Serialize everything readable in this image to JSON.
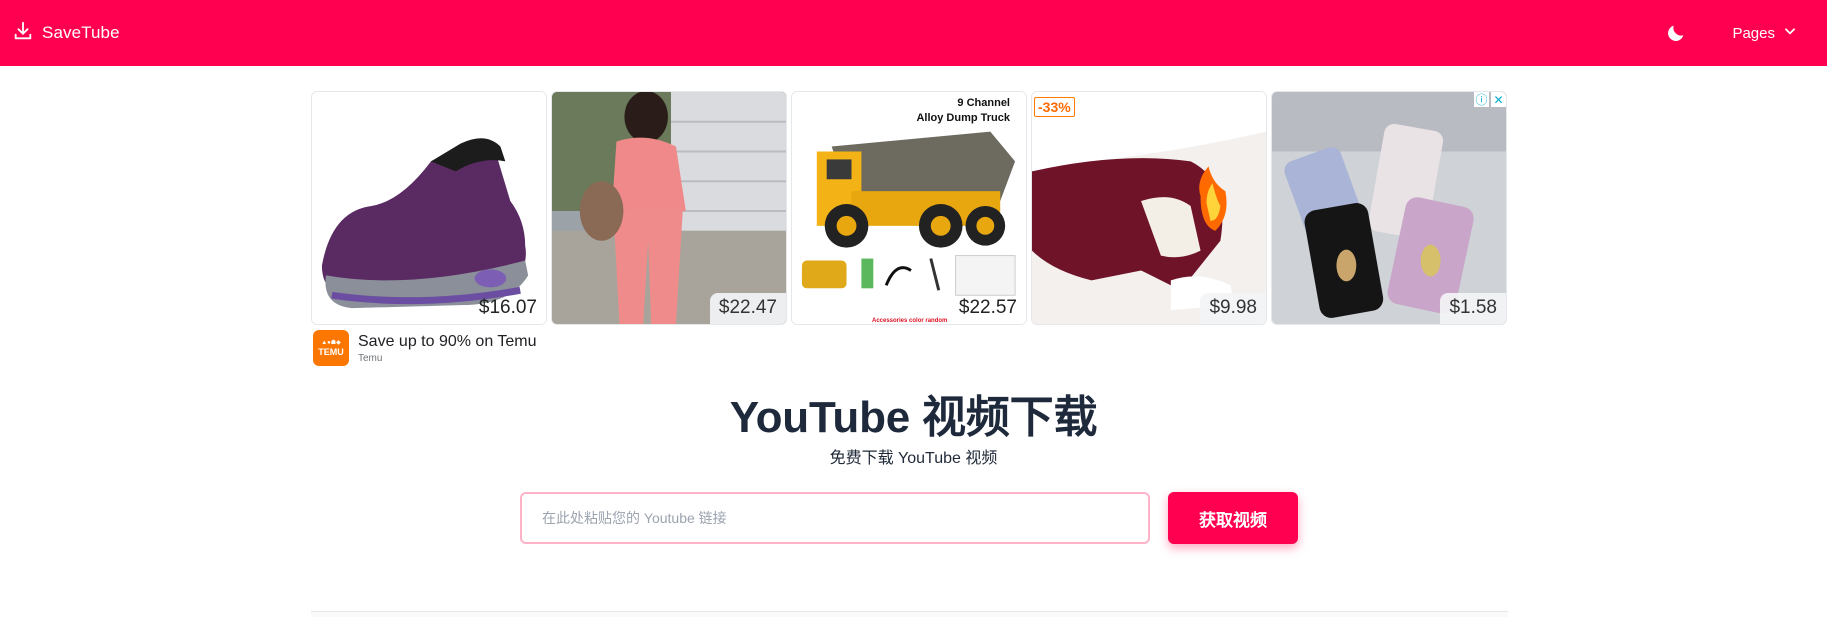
{
  "header": {
    "brand": "SaveTube",
    "pages_label": "Pages",
    "brand_color": "#ff0050",
    "icons": [
      "download-icon",
      "moon-icon",
      "chevron-down-icon"
    ]
  },
  "ad": {
    "cards": [
      {
        "price": "$16.07",
        "alt": "shoe"
      },
      {
        "price": "$22.47",
        "alt": "pink tracksuit"
      },
      {
        "price": "$22.57",
        "alt": "dump truck toy",
        "overlay_title": "9 Channel",
        "overlay_subtitle": "Alloy Dump Truck",
        "caption": "Accessories color random"
      },
      {
        "price": "$9.98",
        "alt": "fleece leggings",
        "badge": "-33%"
      },
      {
        "price": "$1.58",
        "alt": "phone cases"
      }
    ],
    "title": "Save up to 90% on Temu",
    "advertiser": "Temu",
    "logo_text": "TEMU"
  },
  "hero": {
    "title": "YouTube 视频下载",
    "subtitle": "免费下载 YouTube 视频"
  },
  "search": {
    "placeholder": "在此处粘贴您的 Youtube 链接",
    "value": "",
    "button_label": "获取视频"
  }
}
